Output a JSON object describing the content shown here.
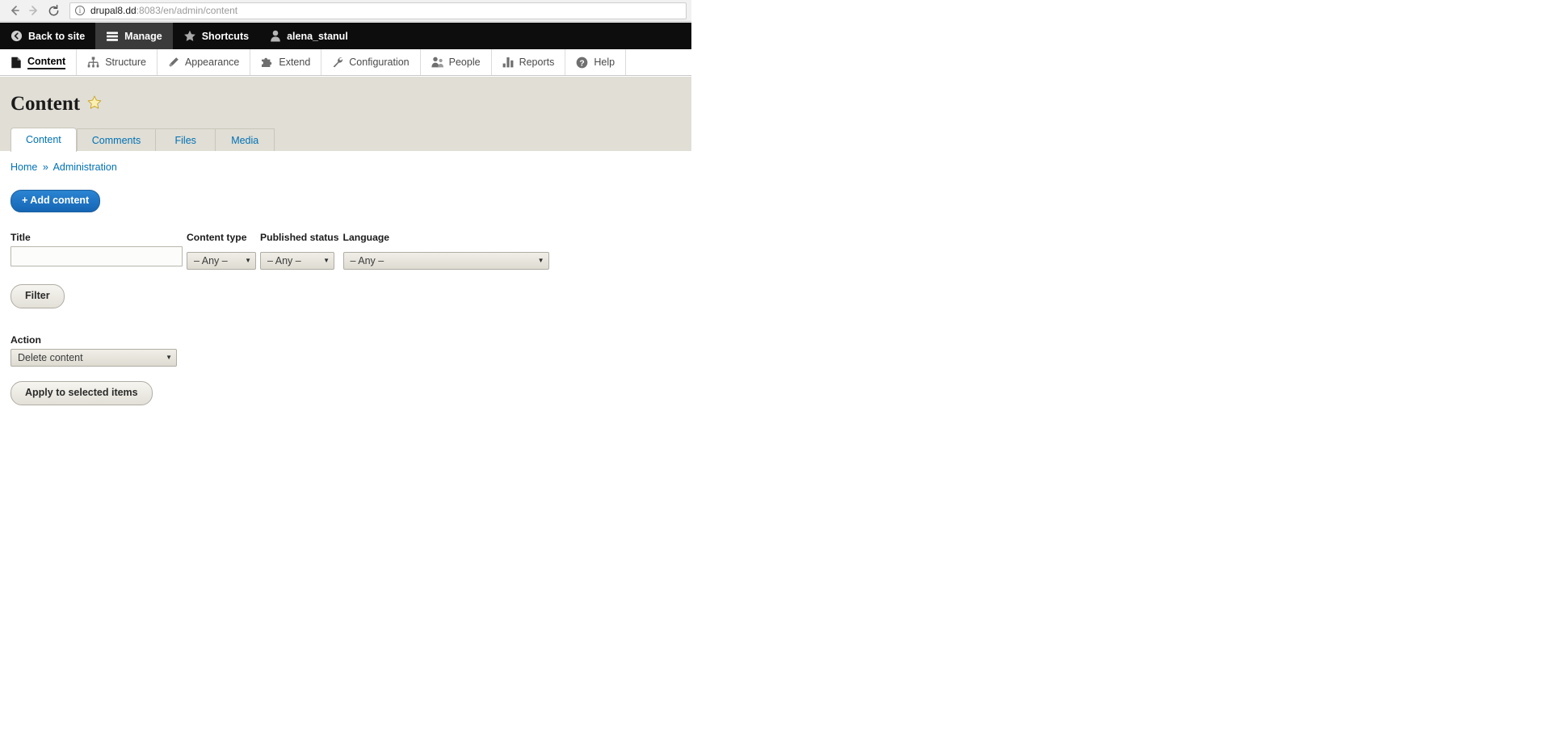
{
  "browser": {
    "back_icon": "back-arrow",
    "forward_icon": "forward-arrow",
    "reload_icon": "reload",
    "info_icon": "ⓘ",
    "url_host": "drupal8.dd",
    "url_rest": ":8083/en/admin/content"
  },
  "admin_toolbar": {
    "items": [
      {
        "label": "Back to site",
        "icon": "back-circle-icon",
        "active": false
      },
      {
        "label": "Manage",
        "icon": "hamburger-icon",
        "active": true
      },
      {
        "label": "Shortcuts",
        "icon": "star-icon",
        "active": false
      },
      {
        "label": "alena_stanul",
        "icon": "user-icon",
        "active": false
      }
    ]
  },
  "admin_menu": {
    "items": [
      {
        "label": "Content",
        "icon": "content-file-icon",
        "active": true
      },
      {
        "label": "Structure",
        "icon": "structure-icon",
        "active": false
      },
      {
        "label": "Appearance",
        "icon": "paintbrush-icon",
        "active": false
      },
      {
        "label": "Extend",
        "icon": "puzzle-piece-icon",
        "active": false
      },
      {
        "label": "Configuration",
        "icon": "wrench-icon",
        "active": false
      },
      {
        "label": "People",
        "icon": "people-icon",
        "active": false
      },
      {
        "label": "Reports",
        "icon": "bar-chart-icon",
        "active": false
      },
      {
        "label": "Help",
        "icon": "question-mark-icon",
        "active": false
      }
    ]
  },
  "page": {
    "title": "Content",
    "star_icon": "★",
    "tabs": [
      {
        "label": "Content",
        "active": true
      },
      {
        "label": "Comments",
        "active": false
      },
      {
        "label": "Files",
        "active": false
      },
      {
        "label": "Media",
        "active": false
      }
    ],
    "breadcrumb": {
      "home": "Home",
      "separator": "»",
      "current": "Administration"
    },
    "add_content_label": "+ Add content"
  },
  "filters": {
    "title": {
      "label": "Title",
      "value": "",
      "placeholder": ""
    },
    "content_type": {
      "label": "Content type",
      "selected": "– Any –",
      "options": [
        "– Any –"
      ]
    },
    "published_status": {
      "label": "Published status",
      "selected": "– Any –",
      "options": [
        "– Any –"
      ]
    },
    "language": {
      "label": "Language",
      "selected": "– Any –",
      "options": [
        "– Any –"
      ]
    },
    "filter_button": "Filter"
  },
  "action": {
    "label": "Action",
    "selected": "Delete content",
    "options": [
      "Delete content"
    ],
    "apply_button": "Apply to selected items"
  },
  "colors": {
    "toolbar_bg": "#0d0d0d",
    "toolbar_active_bg": "#3b3b3b",
    "header_bg": "#e0ded5",
    "link_blue": "#0071b3",
    "primary_button": "#1e78c8",
    "star_yellow": "#f5e27a"
  }
}
